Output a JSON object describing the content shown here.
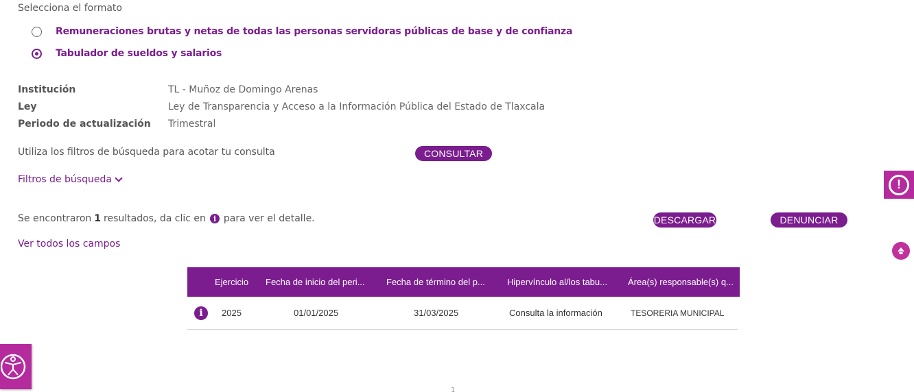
{
  "format": {
    "title": "Selecciona el formato",
    "options": [
      {
        "label": "Remuneraciones brutas y netas de todas las personas servidoras públicas de base y de confianza",
        "selected": false
      },
      {
        "label": "Tabulador de sueldos y salarios",
        "selected": true
      }
    ]
  },
  "info": {
    "institucion_label": "Institución",
    "institucion_value": "TL - Muñoz de Domingo Arenas",
    "ley_label": "Ley",
    "ley_value": "Ley de Transparencia y Acceso a la Información Pública del Estado de Tlaxcala",
    "periodo_label": "Periodo de actualización",
    "periodo_value": "Trimestral"
  },
  "search": {
    "hint": "Utiliza los filtros de búsqueda para acotar tu consulta",
    "consultar_label": "CONSULTAR",
    "filters_label": "Filtros de búsqueda"
  },
  "results": {
    "prefix": "Se encontraron",
    "count": "1",
    "middle": "resultados, da clic en",
    "suffix": "para ver el detalle.",
    "info_glyph": "i",
    "descargar_label": "DESCARGAR",
    "denunciar_label": "DENUNCIAR",
    "ver_todos_label": "Ver todos los campos"
  },
  "table": {
    "headers": [
      "Ejercicio",
      "Fecha de inicio del peri...",
      "Fecha de término del p...",
      "Hipervínculo al/los tabu...",
      "Área(s) responsable(s) q..."
    ],
    "rows": [
      {
        "info_glyph": "i",
        "ejercicio": "2025",
        "fecha_inicio": "01/01/2025",
        "fecha_termino": "31/03/2025",
        "hipervinculo": "Consulta la información",
        "area": "TESORERIA MUNICIPAL"
      }
    ]
  },
  "widgets": {
    "alert_glyph": "!",
    "pager_hint": "1"
  },
  "colors": {
    "primary": "#7b1d8f",
    "accent": "#b52a9d"
  },
  "icons": [
    "radio-empty-icon",
    "radio-checked-icon",
    "chevron-down-icon",
    "info-icon",
    "alert-icon",
    "scroll-up-icon",
    "accessibility-icon"
  ]
}
